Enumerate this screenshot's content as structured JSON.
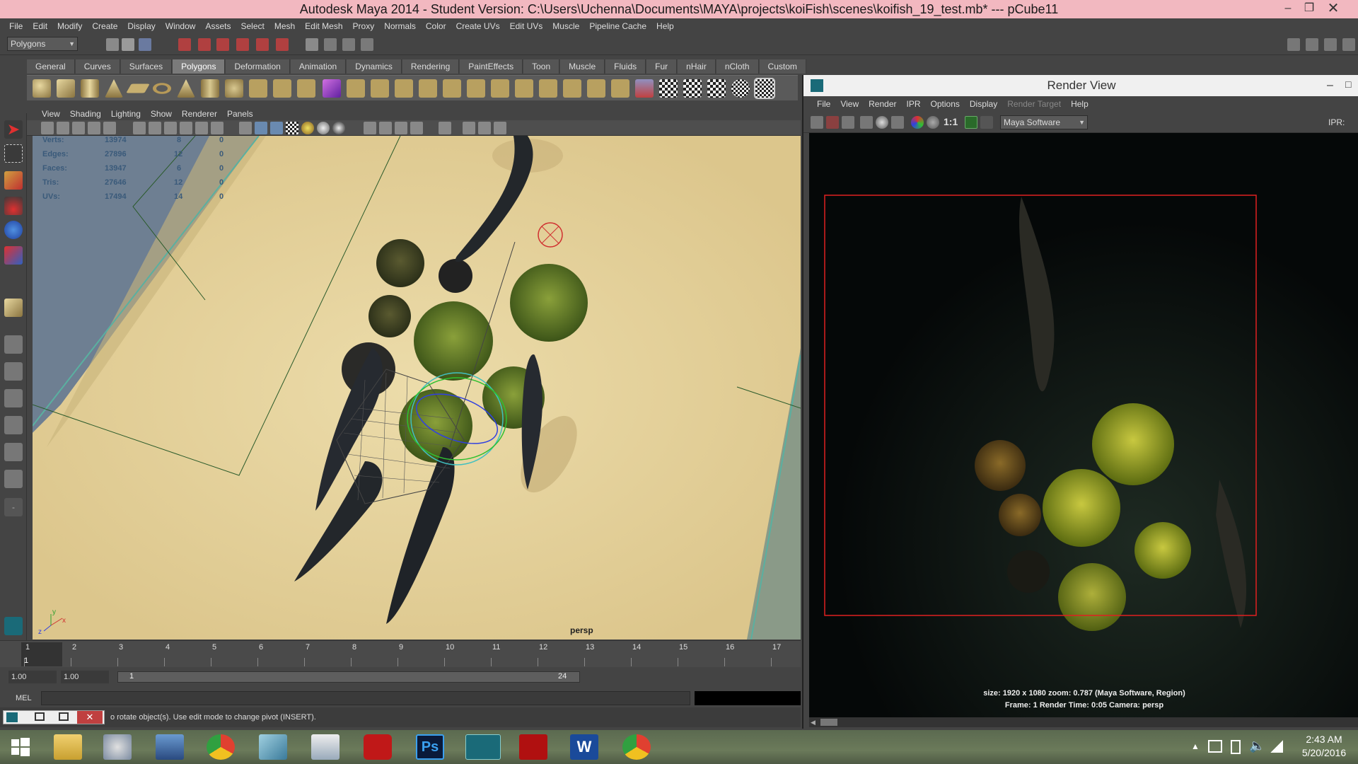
{
  "window": {
    "title": "Autodesk Maya 2014 - Student Version: C:\\Users\\Uchenna\\Documents\\MAYA\\projects\\koiFish\\scenes\\koifish_19_test.mb*   ---   pCube11"
  },
  "menubar": [
    "File",
    "Edit",
    "Modify",
    "Create",
    "Display",
    "Window",
    "Assets",
    "Select",
    "Mesh",
    "Edit Mesh",
    "Proxy",
    "Normals",
    "Color",
    "Create UVs",
    "Edit UVs",
    "Muscle",
    "Pipeline Cache",
    "Help"
  ],
  "status_line": {
    "mode_selector": "Polygons"
  },
  "shelf": {
    "tabs": [
      "General",
      "Curves",
      "Surfaces",
      "Polygons",
      "Deformation",
      "Animation",
      "Dynamics",
      "Rendering",
      "PaintEffects",
      "Toon",
      "Muscle",
      "Fluids",
      "Fur",
      "nHair",
      "nCloth",
      "Custom"
    ],
    "active_tab": "Polygons"
  },
  "viewport": {
    "menu": [
      "View",
      "Shading",
      "Lighting",
      "Show",
      "Renderer",
      "Panels"
    ],
    "camera_label": "persp",
    "hud": [
      {
        "label": "Verts:",
        "v1": "13974",
        "v2": "8",
        "v3": "0"
      },
      {
        "label": "Edges:",
        "v1": "27896",
        "v2": "12",
        "v3": "0"
      },
      {
        "label": "Faces:",
        "v1": "13947",
        "v2": "6",
        "v3": "0"
      },
      {
        "label": "Tris:",
        "v1": "27646",
        "v2": "12",
        "v3": "0"
      },
      {
        "label": "UVs:",
        "v1": "17494",
        "v2": "14",
        "v3": "0"
      }
    ],
    "axis_y": "y",
    "axis_x": "x",
    "axis_z": "z"
  },
  "time_slider": {
    "ticks": [
      "1",
      "2",
      "3",
      "4",
      "5",
      "6",
      "7",
      "8",
      "9",
      "10",
      "11",
      "12",
      "13",
      "14",
      "15",
      "16",
      "17"
    ],
    "current_frame": "1"
  },
  "range_slider": {
    "start": "1.00",
    "playback_start": "1.00",
    "range_start": "1",
    "range_end": "24"
  },
  "command_line": {
    "label": "MEL"
  },
  "help_line": {
    "text": "o rotate object(s). Use edit mode to change pivot (INSERT)."
  },
  "render_view": {
    "title": "Render View",
    "menu": [
      "File",
      "View",
      "Render",
      "IPR",
      "Options",
      "Display"
    ],
    "menu_disabled": "Render Target",
    "menu_help": "Help",
    "ratio_label": "1:1",
    "renderer": "Maya Software",
    "ipr_label": "IPR:",
    "info_line1": "size: 1920 x 1080 zoom: 0.787       (Maya Software, Region)",
    "info_line2": "Frame: 1       Render Time: 0:05       Camera: persp"
  },
  "taskbar": {
    "time": "2:43 AM",
    "date": "5/20/2016",
    "apps": [
      "windows-start",
      "file-explorer",
      "paint",
      "remote-desktop",
      "chrome",
      "notepad-alt",
      "wordpad",
      "creative-cloud",
      "photoshop",
      "maya",
      "acrobat",
      "word",
      "chrome-2"
    ]
  },
  "colors": {
    "accent": "#7a7a7a",
    "render_region": "#e02020",
    "title_bar": "#f2b8c0"
  }
}
